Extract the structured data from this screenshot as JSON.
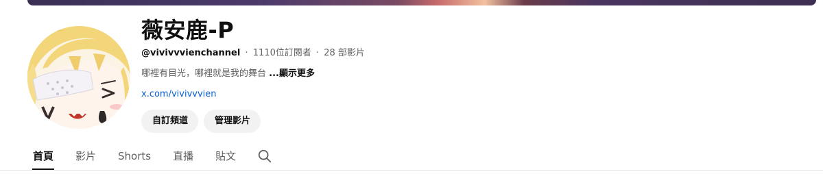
{
  "channel": {
    "name": "薇安鹿-P",
    "handle": "@vivivvvienchannel",
    "subscribers": "1110位訂閱者",
    "videos": "28 部影片",
    "separator": "·",
    "description": "哪裡有目光，哪裡就是我的舞台",
    "more_label": "...顯示更多",
    "link_text": "x.com/vivivvvien"
  },
  "buttons": {
    "customize_label": "自訂頻道",
    "manage_label": "管理影片"
  },
  "tabs": [
    {
      "label": "首頁",
      "active": true
    },
    {
      "label": "影片",
      "active": false
    },
    {
      "label": "Shorts",
      "active": false
    },
    {
      "label": "直播",
      "active": false
    },
    {
      "label": "貼文",
      "active": false
    }
  ],
  "icons": {
    "search": "search-icon",
    "avatar": "avatar"
  },
  "colors": {
    "link": "#065fd4",
    "text_primary": "#0f0f0f",
    "text_secondary": "#606060",
    "button_bg": "#f2f2f2"
  }
}
